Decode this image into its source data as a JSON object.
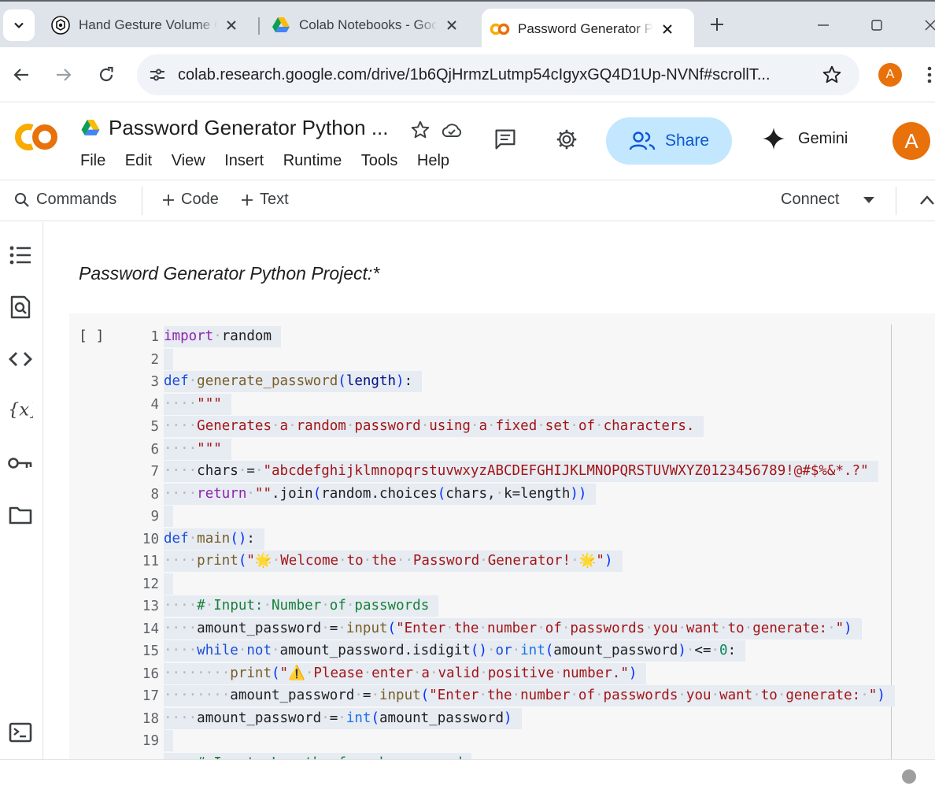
{
  "browser": {
    "tabs": [
      {
        "title": "Hand Gesture Volume Control",
        "favicon": "chatgpt-icon"
      },
      {
        "title": "Colab Notebooks - Google Drive",
        "favicon": "google-drive-icon"
      },
      {
        "title": "Password Generator Python",
        "favicon": "colab-icon",
        "active": true
      }
    ],
    "url": "colab.research.google.com/drive/1b6QjHrmzLutmp54cIgyxGQ4D1Up-NVNf#scrollT...",
    "profile_initial": "A"
  },
  "colab": {
    "notebook_title": "Password Generator Python ...",
    "menu": [
      "File",
      "Edit",
      "View",
      "Insert",
      "Runtime",
      "Tools",
      "Help"
    ],
    "share_label": "Share",
    "gemini_label": "Gemini",
    "avatar_initial": "A",
    "toolbar": {
      "commands": "Commands",
      "code": "Code",
      "text": "Text",
      "connect": "Connect"
    }
  },
  "markdown_cell": {
    "text": "Password Generator Python Project:*"
  },
  "code_cell": {
    "run_bracket": "[ ]",
    "line_numbers": [
      "1",
      "2",
      "3",
      "4",
      "5",
      "6",
      "7",
      "8",
      "9",
      "10",
      "11",
      "12",
      "13",
      "14",
      "15",
      "16",
      "17",
      "18",
      "19"
    ]
  },
  "colors": {
    "accent": "#0b57d0",
    "share_bg": "#c2e7ff",
    "avatar": "#e8710a",
    "keyword": "#8e24aa",
    "string": "#a31515",
    "comment": "#188038"
  }
}
